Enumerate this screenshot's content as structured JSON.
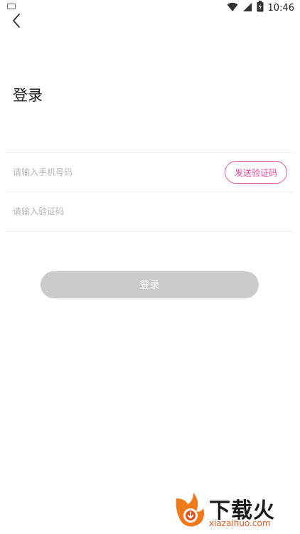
{
  "status_bar": {
    "time": "10:46"
  },
  "header": {
    "title": "登录"
  },
  "form": {
    "phone_placeholder": "请输入手机号码",
    "code_placeholder": "请输入验证码",
    "send_code_label": "发送验证码"
  },
  "actions": {
    "login_label": "登录"
  },
  "watermark": {
    "brand_cn": "下载火",
    "brand_en": "xiazaihuo.com"
  },
  "colors": {
    "accent": "#e8469b",
    "button_disabled": "#cbcbcb",
    "divider": "#eeeeee",
    "placeholder": "#b5b5b5"
  },
  "icons": {
    "keyboard": "keyboard-icon",
    "wifi": "wifi-icon",
    "signal": "signal-icon",
    "battery": "battery-icon",
    "back": "back-arrow-icon"
  }
}
